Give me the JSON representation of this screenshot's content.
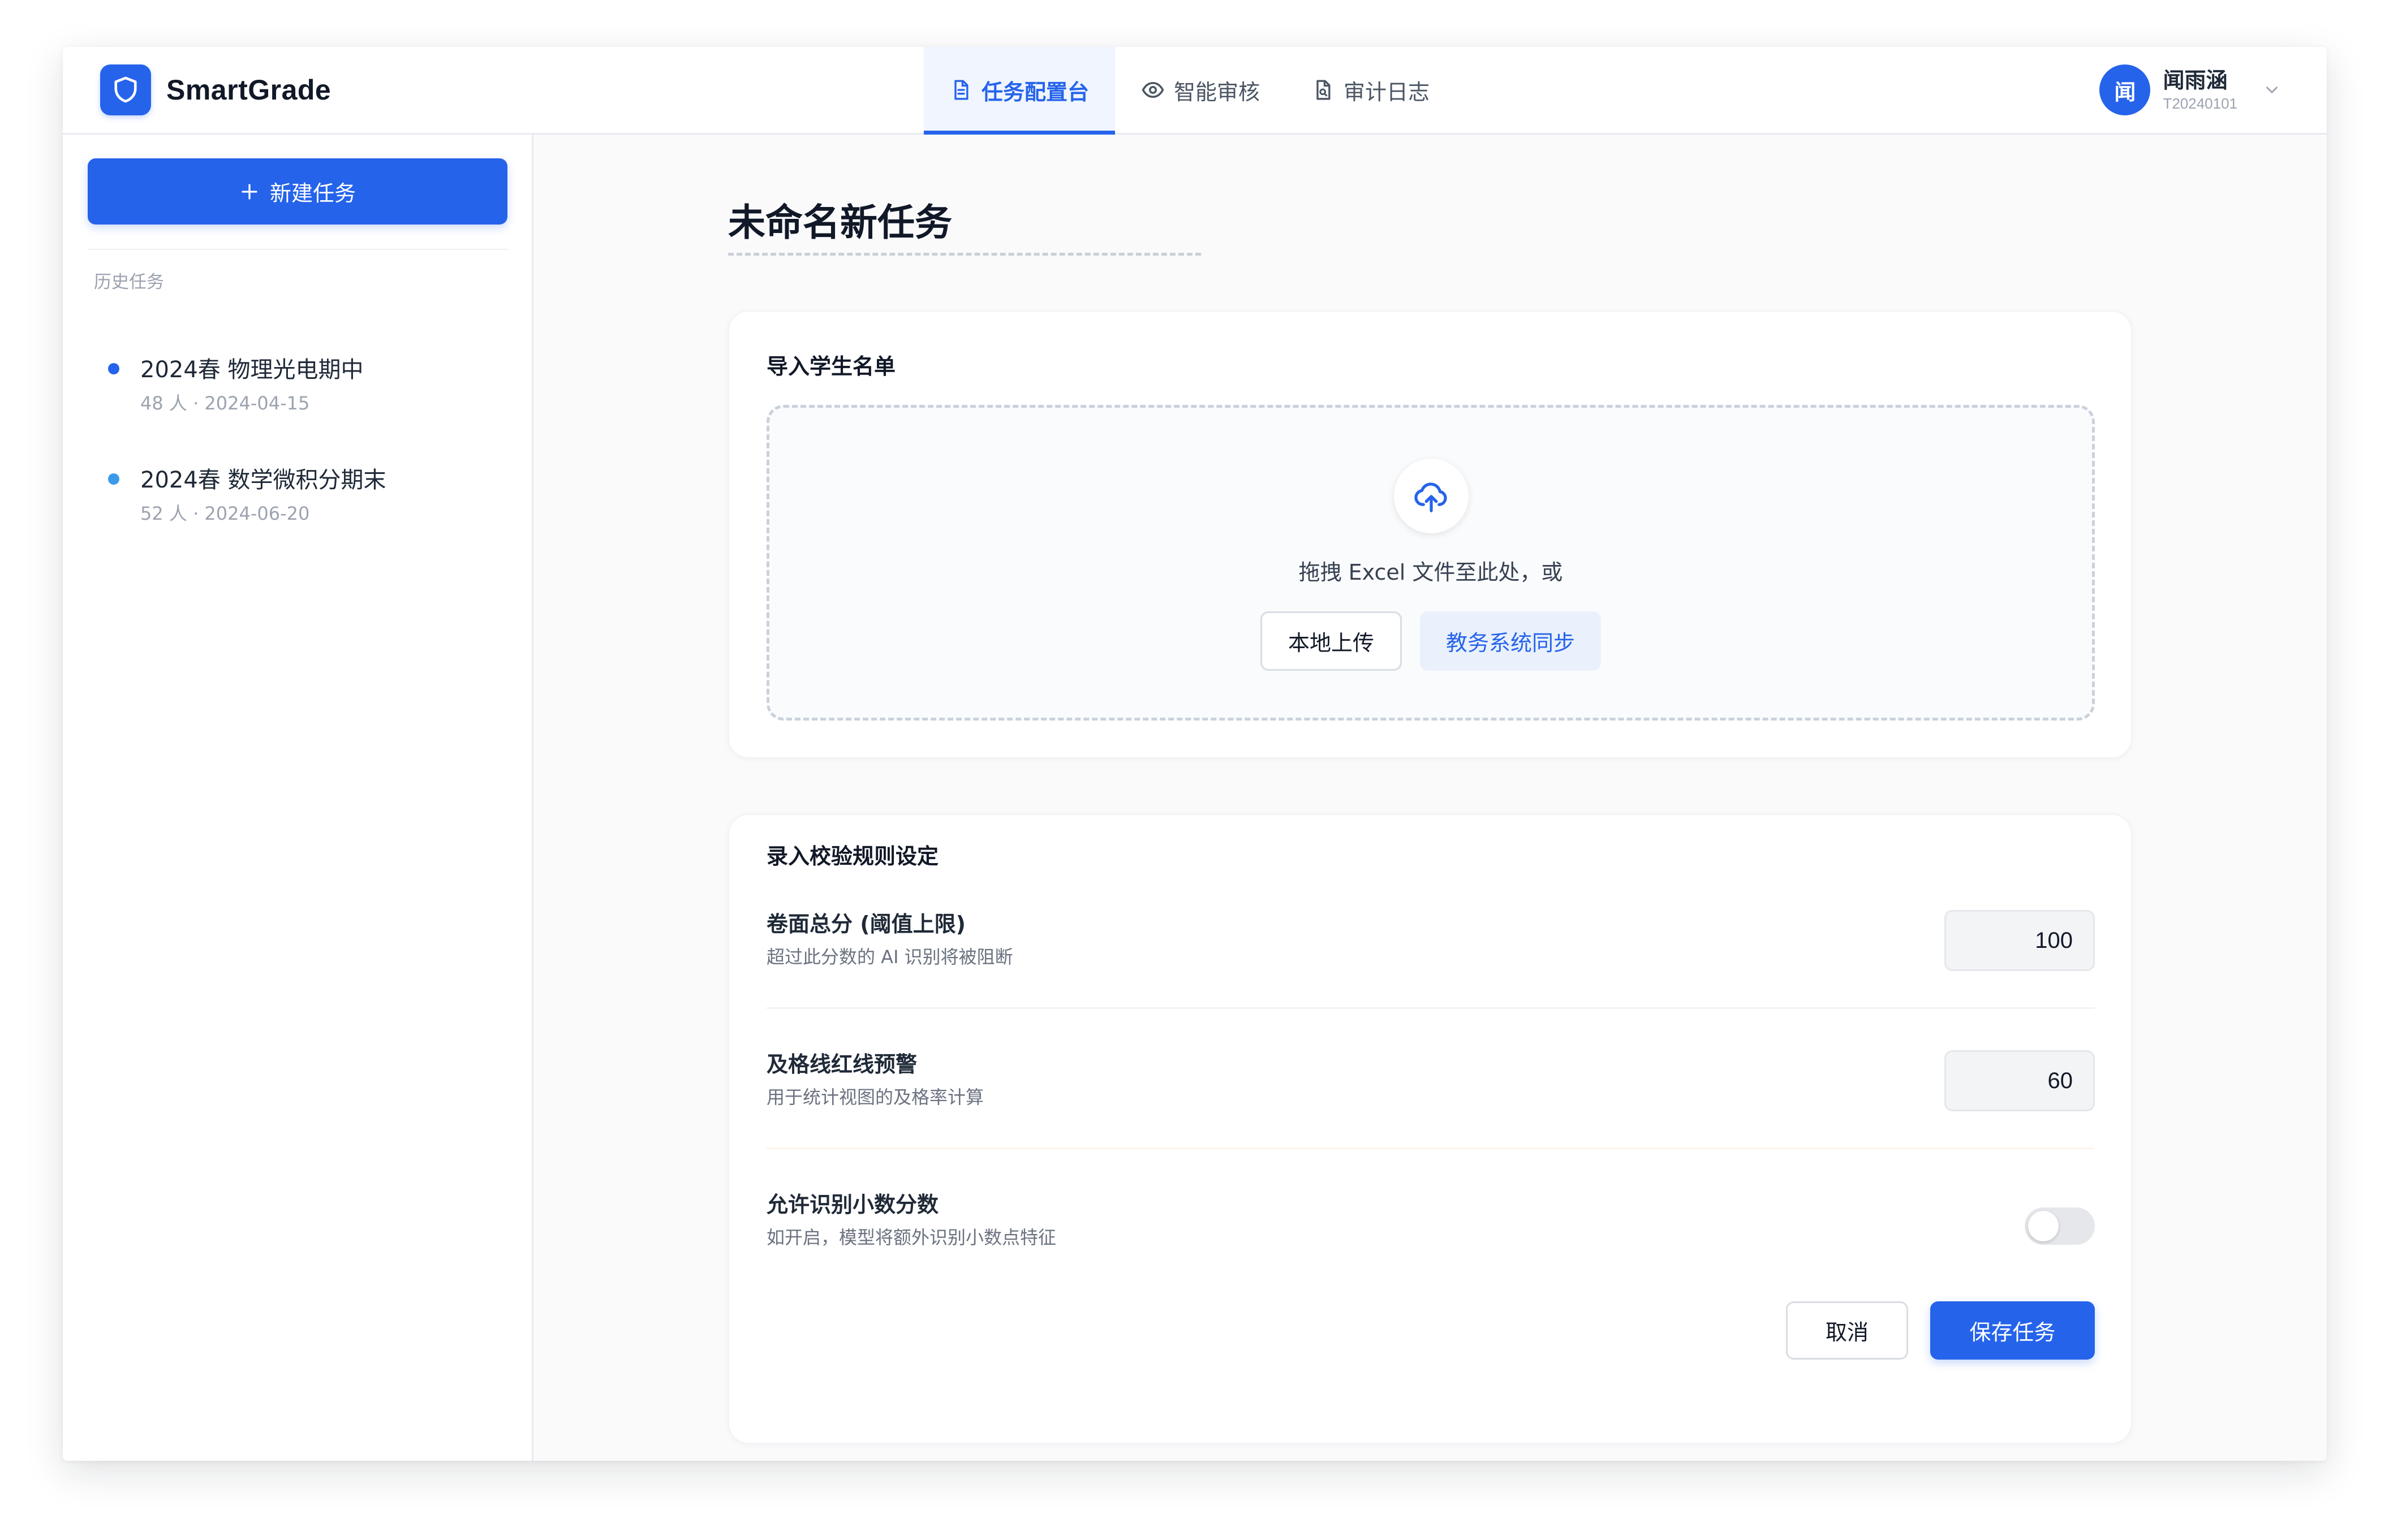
{
  "app": {
    "name": "SmartGrade",
    "logo_icon": "shield-icon",
    "accent_color": "#2563eb"
  },
  "nav": {
    "tabs": [
      {
        "label": "任务配置台",
        "icon": "document-icon",
        "active": true
      },
      {
        "label": "智能审核",
        "icon": "eye-icon",
        "active": false
      },
      {
        "label": "审计日志",
        "icon": "file-search-icon",
        "active": false
      }
    ]
  },
  "user": {
    "avatar_char": "闻",
    "name": "闻雨涵",
    "id": "T20240101"
  },
  "sidebar": {
    "new_task_label": "新建任务",
    "history_label": "历史任务",
    "history": [
      {
        "title": "2024春 物理光电期中",
        "meta": "48 人 · 2024-04-15",
        "dot_color": "#2563eb"
      },
      {
        "title": "2024春 数学微积分期末",
        "meta": "52 人 · 2024-06-20",
        "dot_color": "#3b9ae8"
      }
    ]
  },
  "main": {
    "title": "未命名新任务",
    "import_card": {
      "title": "导入学生名单",
      "drop_text": "拖拽 Excel 文件至此处，或",
      "local_upload_label": "本地上传",
      "sync_label": "教务系统同步"
    },
    "rules_card": {
      "title": "录入校验规则设定",
      "rules": [
        {
          "label": "卷面总分 (阈值上限)",
          "desc": "超过此分数的 AI 识别将被阻断",
          "value": "100"
        },
        {
          "label": "及格线红线预警",
          "desc": "用于统计视图的及格率计算",
          "value": "60"
        },
        {
          "label": "允许识别小数分数",
          "desc": "如开启，模型将额外识别小数点特征",
          "enabled": false
        }
      ],
      "cancel_label": "取消",
      "save_label": "保存任务"
    }
  }
}
